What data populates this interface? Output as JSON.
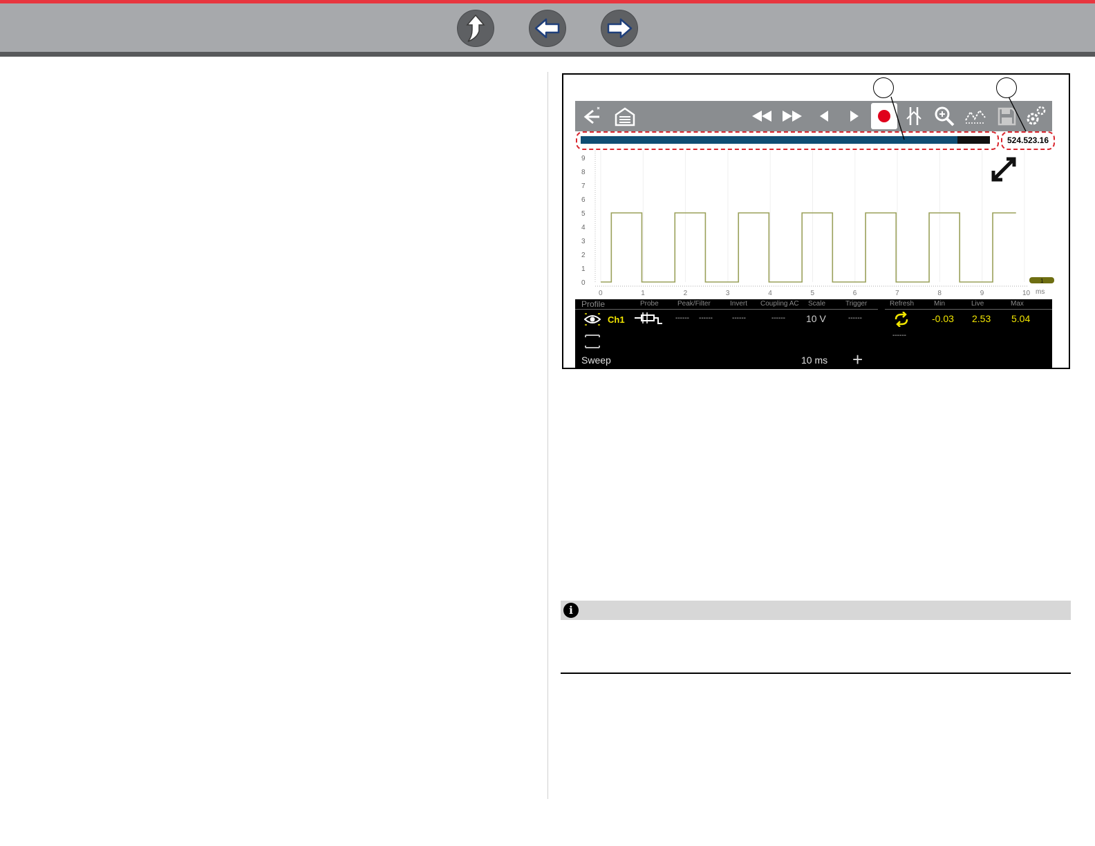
{
  "nav": {
    "buttons": [
      {
        "name": "up-arrow-button",
        "icon": "up-arrow-icon"
      },
      {
        "name": "back-arrow-button",
        "icon": "left-arrow-icon"
      },
      {
        "name": "forward-arrow-button",
        "icon": "right-arrow-icon"
      }
    ]
  },
  "colors": {
    "top_red": "#e8363f",
    "top_bar": "#a7a9ac",
    "toolbar": "#8a8d90",
    "trace": "#9aa05a",
    "record": "#e0001b",
    "readout_yellow": "#f2e600",
    "dashed_highlight": "#d9262e"
  },
  "figure": {
    "toolbar_icons": [
      "back-exit-icon",
      "home-icon",
      "rewind-icon",
      "fast-forward-icon",
      "step-back-icon",
      "step-forward-icon",
      "record-icon",
      "cursor-icon",
      "zoom-icon",
      "trace-icon",
      "save-icon",
      "settings-icon"
    ],
    "buffer_fill_fraction": 0.92,
    "counter": "524.523.16",
    "plot": {
      "y_ticks": [
        "9",
        "8",
        "7",
        "6",
        "5",
        "4",
        "3",
        "2",
        "1",
        "0"
      ],
      "x_ticks": [
        "0",
        "1",
        "2",
        "3",
        "4",
        "5",
        "6",
        "7",
        "8",
        "9",
        "10"
      ],
      "x_unit": "ms",
      "channel_marker": "1",
      "waveform_low": 0,
      "waveform_high": 5,
      "waveform_period_ms": 1.5
    },
    "panel": {
      "headers": {
        "profile": "Profile",
        "probe": "Probe",
        "peak_filter": "Peak/Filter",
        "invert": "Invert",
        "coupling": "Coupling AC",
        "scale": "Scale",
        "trigger": "Trigger",
        "refresh": "Refresh",
        "min": "Min",
        "live": "Live",
        "max": "Max"
      },
      "ch1": {
        "label": "Ch1",
        "peak": "------",
        "filter": "------",
        "invert": "------",
        "coupling": "------",
        "scale": "10 V",
        "trigger": "------",
        "min": "-0.03",
        "live": "2.53",
        "max": "5.04"
      },
      "ch2_dash": "------",
      "sweep_label": "Sweep",
      "sweep_value": "10 ms",
      "add_label": "+"
    }
  }
}
